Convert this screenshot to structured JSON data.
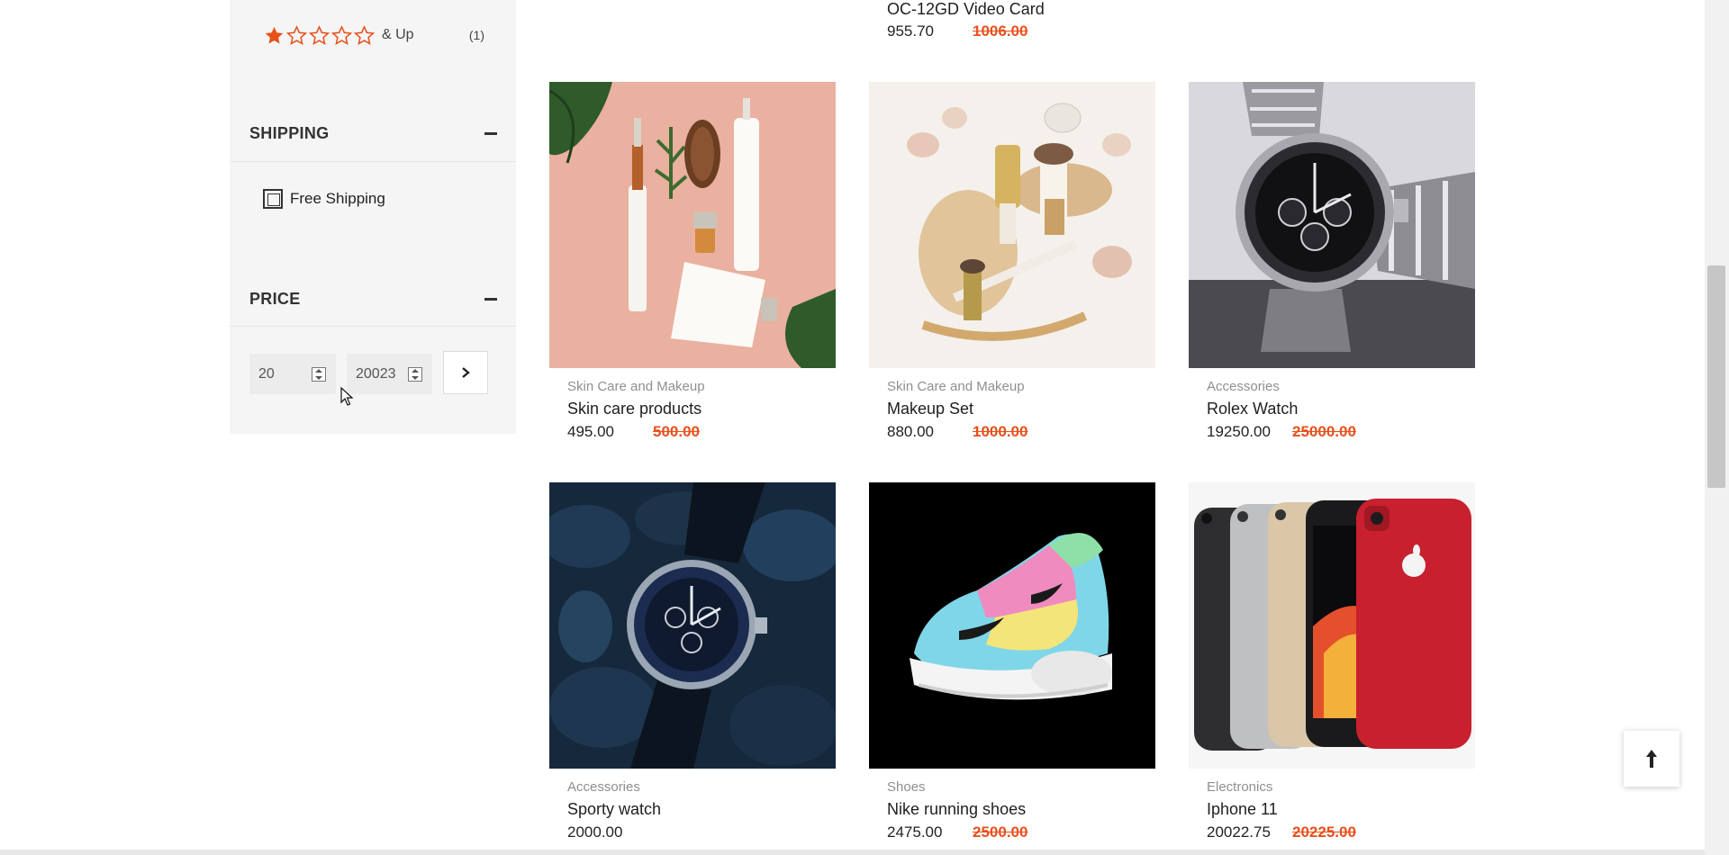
{
  "sidebar": {
    "rating_filter": {
      "stars_filled": 1,
      "stars_total": 5,
      "suffix": "& Up",
      "count": "(1)"
    },
    "shipping": {
      "title": "SHIPPING",
      "option_label": "Free Shipping"
    },
    "price": {
      "title": "PRICE",
      "min_value": "20",
      "max_value": "20023"
    }
  },
  "top_partial_product": {
    "name": "OC-12GD Video Card",
    "price": "955.70",
    "old_price": "1006.00"
  },
  "products": [
    {
      "category": "Skin Care and Makeup",
      "name": "Skin care products",
      "price": "495.00",
      "old_price": "500.00"
    },
    {
      "category": "Skin Care and Makeup",
      "name": "Makeup Set",
      "price": "880.00",
      "old_price": "1000.00"
    },
    {
      "category": "Accessories",
      "name": "Rolex Watch",
      "price": "19250.00",
      "old_price": "25000.00"
    },
    {
      "category": "Accessories",
      "name": "Sporty watch",
      "price": "2000.00",
      "old_price": ""
    },
    {
      "category": "Shoes",
      "name": "Nike running shoes",
      "price": "2475.00",
      "old_price": "2500.00"
    },
    {
      "category": "Electronics",
      "name": "Iphone 11",
      "price": "20022.75",
      "old_price": "20225.00"
    }
  ],
  "colors": {
    "accent": "#e8501c",
    "sidebar_bg": "#f5f5f5",
    "muted_text": "#8f8f8f"
  },
  "icons": {
    "rating": "star-icon",
    "shipping_collapse": "minus-icon",
    "price_collapse": "minus-icon",
    "apply": "chevron-right-icon",
    "scroll_top": "arrow-up-icon",
    "checkbox": "checkbox-icon"
  }
}
